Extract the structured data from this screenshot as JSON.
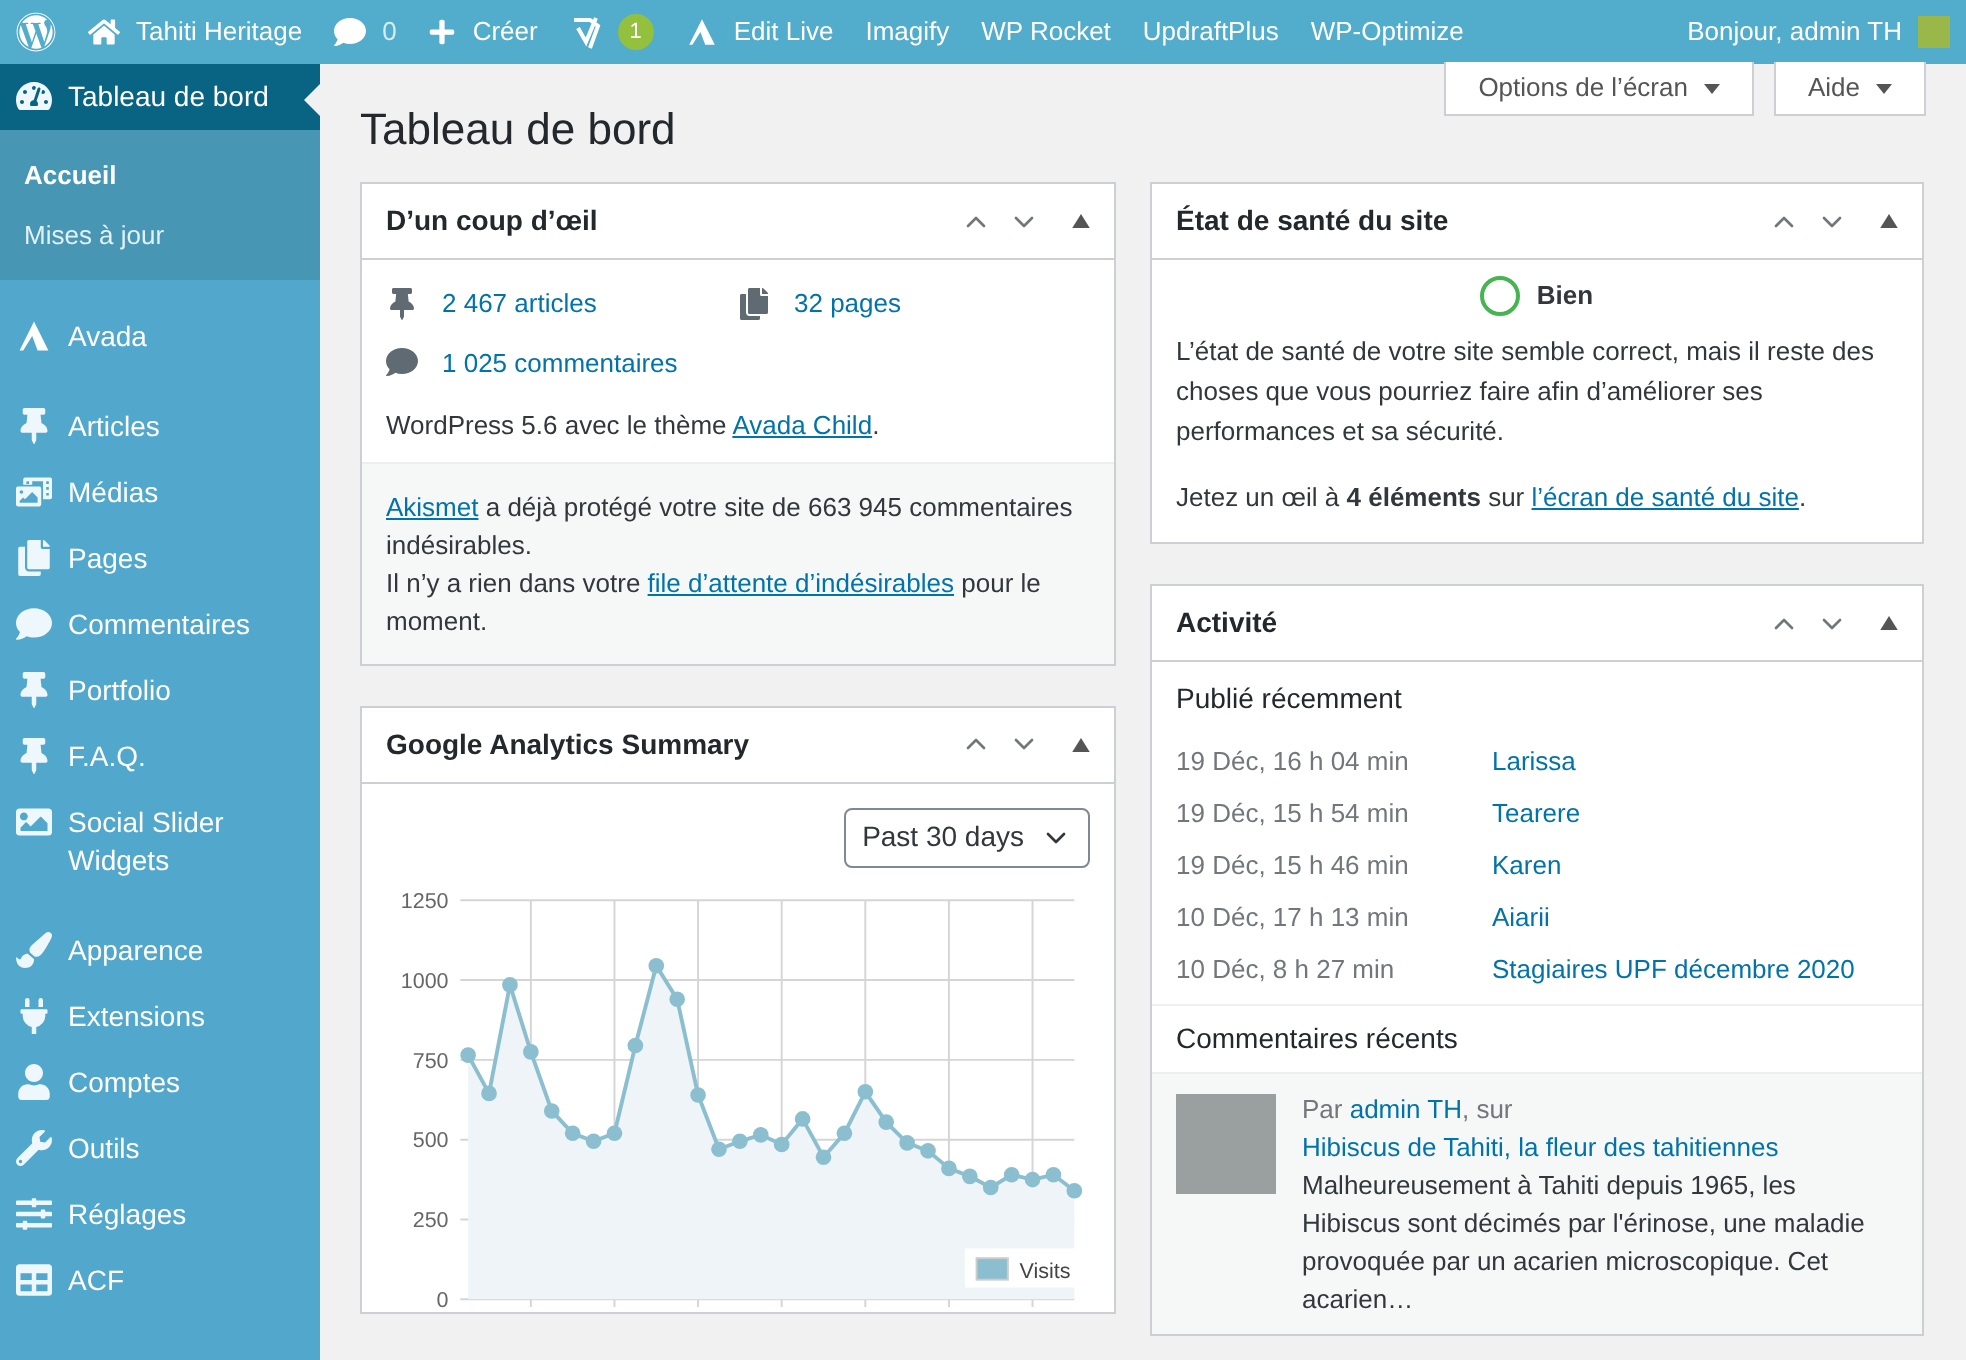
{
  "admin_bar": {
    "site": "Tahiti Heritage",
    "comments": "0",
    "new": "Créer",
    "seo_badge": "1",
    "edit_live": "Edit Live",
    "links": [
      "Imagify",
      "WP Rocket",
      "UpdraftPlus",
      "WP-Optimize"
    ],
    "greeting": "Bonjour, admin TH"
  },
  "sidebar": {
    "groups": [
      [
        {
          "label": "Tableau de bord",
          "selected": true,
          "children": [
            {
              "label": "Accueil",
              "selected": true
            },
            {
              "label": "Mises à jour",
              "selected": false
            }
          ]
        }
      ],
      [
        {
          "label": "Avada",
          "selected": false
        }
      ],
      [
        {
          "label": "Articles",
          "selected": false
        },
        {
          "label": "Médias",
          "selected": false
        },
        {
          "label": "Pages",
          "selected": false
        },
        {
          "label": "Commentaires",
          "selected": false
        },
        {
          "label": "Portfolio",
          "selected": false
        },
        {
          "label": "F.A.Q.",
          "selected": false
        },
        {
          "label": "Social Slider Widgets",
          "selected": false
        }
      ],
      [
        {
          "label": "Apparence",
          "selected": false
        },
        {
          "label": "Extensions",
          "selected": false
        },
        {
          "label": "Comptes",
          "selected": false
        },
        {
          "label": "Outils",
          "selected": false
        },
        {
          "label": "Réglages",
          "selected": false
        },
        {
          "label": "ACF",
          "selected": false
        }
      ]
    ]
  },
  "screen_buttons": [
    "Options de l’écran",
    "Aide"
  ],
  "page_title": "Tableau de bord",
  "glance": {
    "title": "D’un coup d’œil",
    "articles": "2 467 articles",
    "pages": "32 pages",
    "comments": "1 025 commentaires",
    "version": "WordPress 5.6 avec le thème ",
    "theme": "Avada Child",
    "version_end": ".",
    "akismet_link": "Akismet",
    "akismet_text": " a déjà protégé votre site de 663 945 commentaires indésirables.",
    "queue_text": "Il n’y a rien dans votre ",
    "queue_link": "file d’attente d’indésirables",
    "queue_end": " pour le moment."
  },
  "analytics": {
    "title": "Google Analytics Summary",
    "period": "Past 30 days",
    "chart_data": {
      "type": "area",
      "grid": true,
      "ylim": [
        0,
        1250
      ],
      "yticks": [
        0,
        250,
        500,
        750,
        1000,
        1250
      ],
      "series": [
        {
          "name": "Visits",
          "color": "#8bbfd0",
          "values": [
            765,
            645,
            985,
            775,
            590,
            520,
            495,
            520,
            795,
            1045,
            940,
            640,
            470,
            495,
            515,
            485,
            565,
            445,
            520,
            650,
            555,
            490,
            465,
            410,
            385,
            350,
            390,
            375,
            390,
            340
          ]
        }
      ]
    }
  },
  "health": {
    "title": "État de santé du site",
    "status": "Bien",
    "text": "L’état de santé de votre site semble correct, mais il reste des choses que vous pourriez faire afin d’améliorer ses performances et sa sécurité.",
    "prompt": "Jetez un œil à **4 éléments** sur ",
    "link": "l’écran de santé du site",
    "end": "."
  },
  "activity": {
    "title": "Activité",
    "published_heading": "Publié récemment",
    "published": [
      {
        "date": "19 Déc, 16 h 04 min",
        "title": "Larissa"
      },
      {
        "date": "19 Déc, 15 h 54 min",
        "title": "Tearere"
      },
      {
        "date": "19 Déc, 15 h 46 min",
        "title": "Karen"
      },
      {
        "date": "10 Déc, 17 h 13 min",
        "title": "Aiarii"
      },
      {
        "date": "10 Déc, 8 h 27 min",
        "title": "Stagiaires UPF décembre 2020"
      }
    ],
    "comments_heading": "Commentaires récents",
    "comments": [
      {
        "by": "Par ",
        "author": "admin TH",
        "on": ", sur ",
        "post": "Hibiscus de Tahiti, la fleur des tahitiennes",
        "excerpt": "Malheureusement à Tahiti depuis 1965, les Hibiscus sont décimés par l'érinose, une maladie provoquée par un acarien microscopique. Cet acarien…"
      }
    ]
  }
}
